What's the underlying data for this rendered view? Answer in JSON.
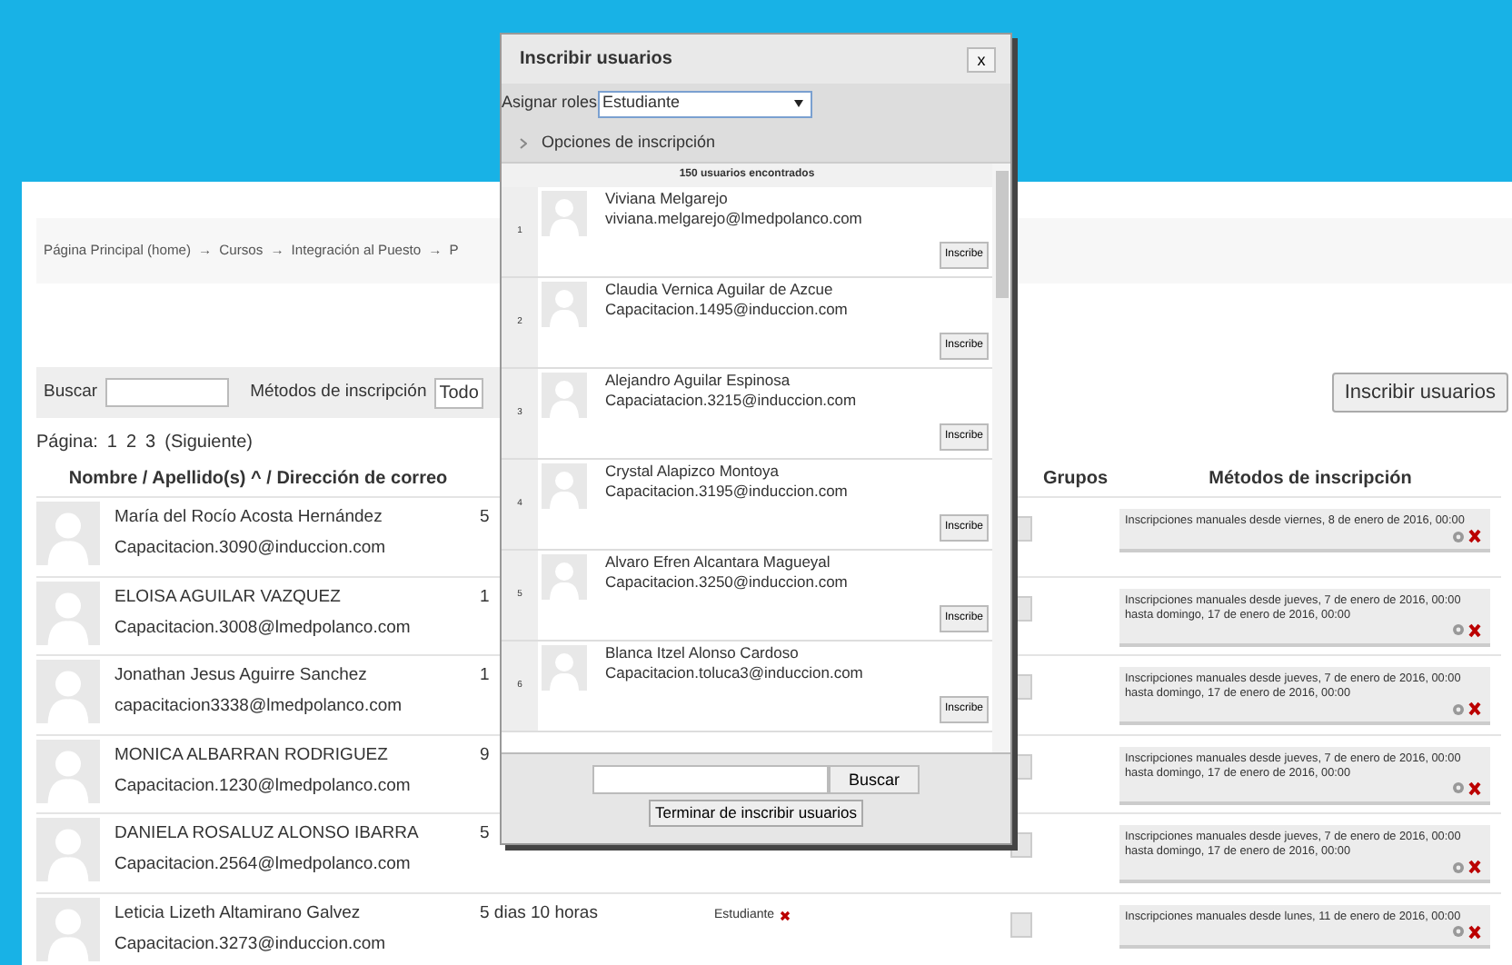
{
  "breadcrumb": {
    "separator": "→",
    "items": [
      "Página Principal (home)",
      "Cursos",
      "Integración al Puesto",
      "P"
    ]
  },
  "filters": {
    "search_label": "Buscar",
    "methods_label": "Métodos de inscripción",
    "methods_value": "Todo"
  },
  "enrol_button": "Inscribir usuarios",
  "pagination": {
    "label": "Página:",
    "pages": [
      "1",
      "2",
      "3"
    ],
    "next": "(Siguiente)"
  },
  "table": {
    "columns": [
      {
        "kind": "name",
        "label": "Nombre / Apellido(s) ^ / Dirección de correo"
      },
      {
        "kind": "blank"
      },
      {
        "kind": "blank"
      },
      {
        "kind": "groups",
        "label": "Grupos"
      },
      {
        "kind": "methods",
        "label": "Métodos de inscripción"
      }
    ],
    "rows": [
      {
        "name": "María del Rocío Acosta Hernández",
        "email": "Capacitacion.3090@induccion.com",
        "column_2": "5",
        "method": "Inscripciones manuales desde viernes, 8 de enero de 2016, 00:00"
      },
      {
        "name": "ELOISA AGUILAR VAZQUEZ",
        "email": "Capacitacion.3008@lmedpolanco.com",
        "column_2": "1",
        "method": "Inscripciones manuales desde jueves, 7 de enero de 2016, 00:00 hasta domingo, 17 de enero de 2016, 00:00"
      },
      {
        "name": "Jonathan Jesus Aguirre Sanchez",
        "email": "capacitacion3338@lmedpolanco.com",
        "column_2": "1",
        "method": "Inscripciones manuales desde jueves, 7 de enero de 2016, 00:00 hasta domingo, 17 de enero de 2016, 00:00"
      },
      {
        "name": "MONICA ALBARRAN RODRIGUEZ",
        "email": "Capacitacion.1230@lmedpolanco.com",
        "column_2": "9",
        "method": "Inscripciones manuales desde jueves, 7 de enero de 2016, 00:00 hasta domingo, 17 de enero de 2016, 00:00"
      },
      {
        "name": "DANIELA ROSALUZ ALONSO IBARRA",
        "email": "Capacitacion.2564@lmedpolanco.com",
        "column_2": "5",
        "method": "Inscripciones manuales desde jueves, 7 de enero de 2016, 00:00 hasta domingo, 17 de enero de 2016, 00:00"
      },
      {
        "name": "Leticia Lizeth Altamirano Galvez",
        "email": "Capacitacion.3273@induccion.com",
        "column_2": "5 dias 10 horas",
        "role": "Estudiante",
        "method": "Inscripciones manuales desde lunes, 11 de enero de 2016, 00:00"
      }
    ]
  },
  "dialog": {
    "title": "Inscribir usuarios",
    "close": "x",
    "role_label": "Asignar roles",
    "role_value": "Estudiante",
    "options_label": "Opciones de inscripción",
    "count": "150 usuarios encontrados",
    "users": [
      {
        "number": "1",
        "name": "Viviana Melgarejo",
        "email": "viviana.melgarejo@lmedpolanco.com",
        "button": "Inscribe"
      },
      {
        "number": "2",
        "name": "Claudia Vernica Aguilar de Azcue",
        "email": "Capacitacion.1495@induccion.com",
        "button": "Inscribe"
      },
      {
        "number": "3",
        "name": "Alejandro Aguilar Espinosa",
        "email": "Capaciatacion.3215@induccion.com",
        "button": "Inscribe"
      },
      {
        "number": "4",
        "name": "Crystal Alapizco Montoya",
        "email": "Capacitacion.3195@induccion.com",
        "button": "Inscribe"
      },
      {
        "number": "5",
        "name": "Alvaro Efren Alcantara Magueyal",
        "email": "Capacitacion.3250@induccion.com",
        "button": "Inscribe"
      },
      {
        "number": "6",
        "name": "Blanca Itzel Alonso Cardoso",
        "email": "Capacitacion.toluca3@induccion.com",
        "button": "Inscribe"
      }
    ],
    "search_button": "Buscar",
    "finish_button": "Terminar de inscribir usuarios"
  }
}
